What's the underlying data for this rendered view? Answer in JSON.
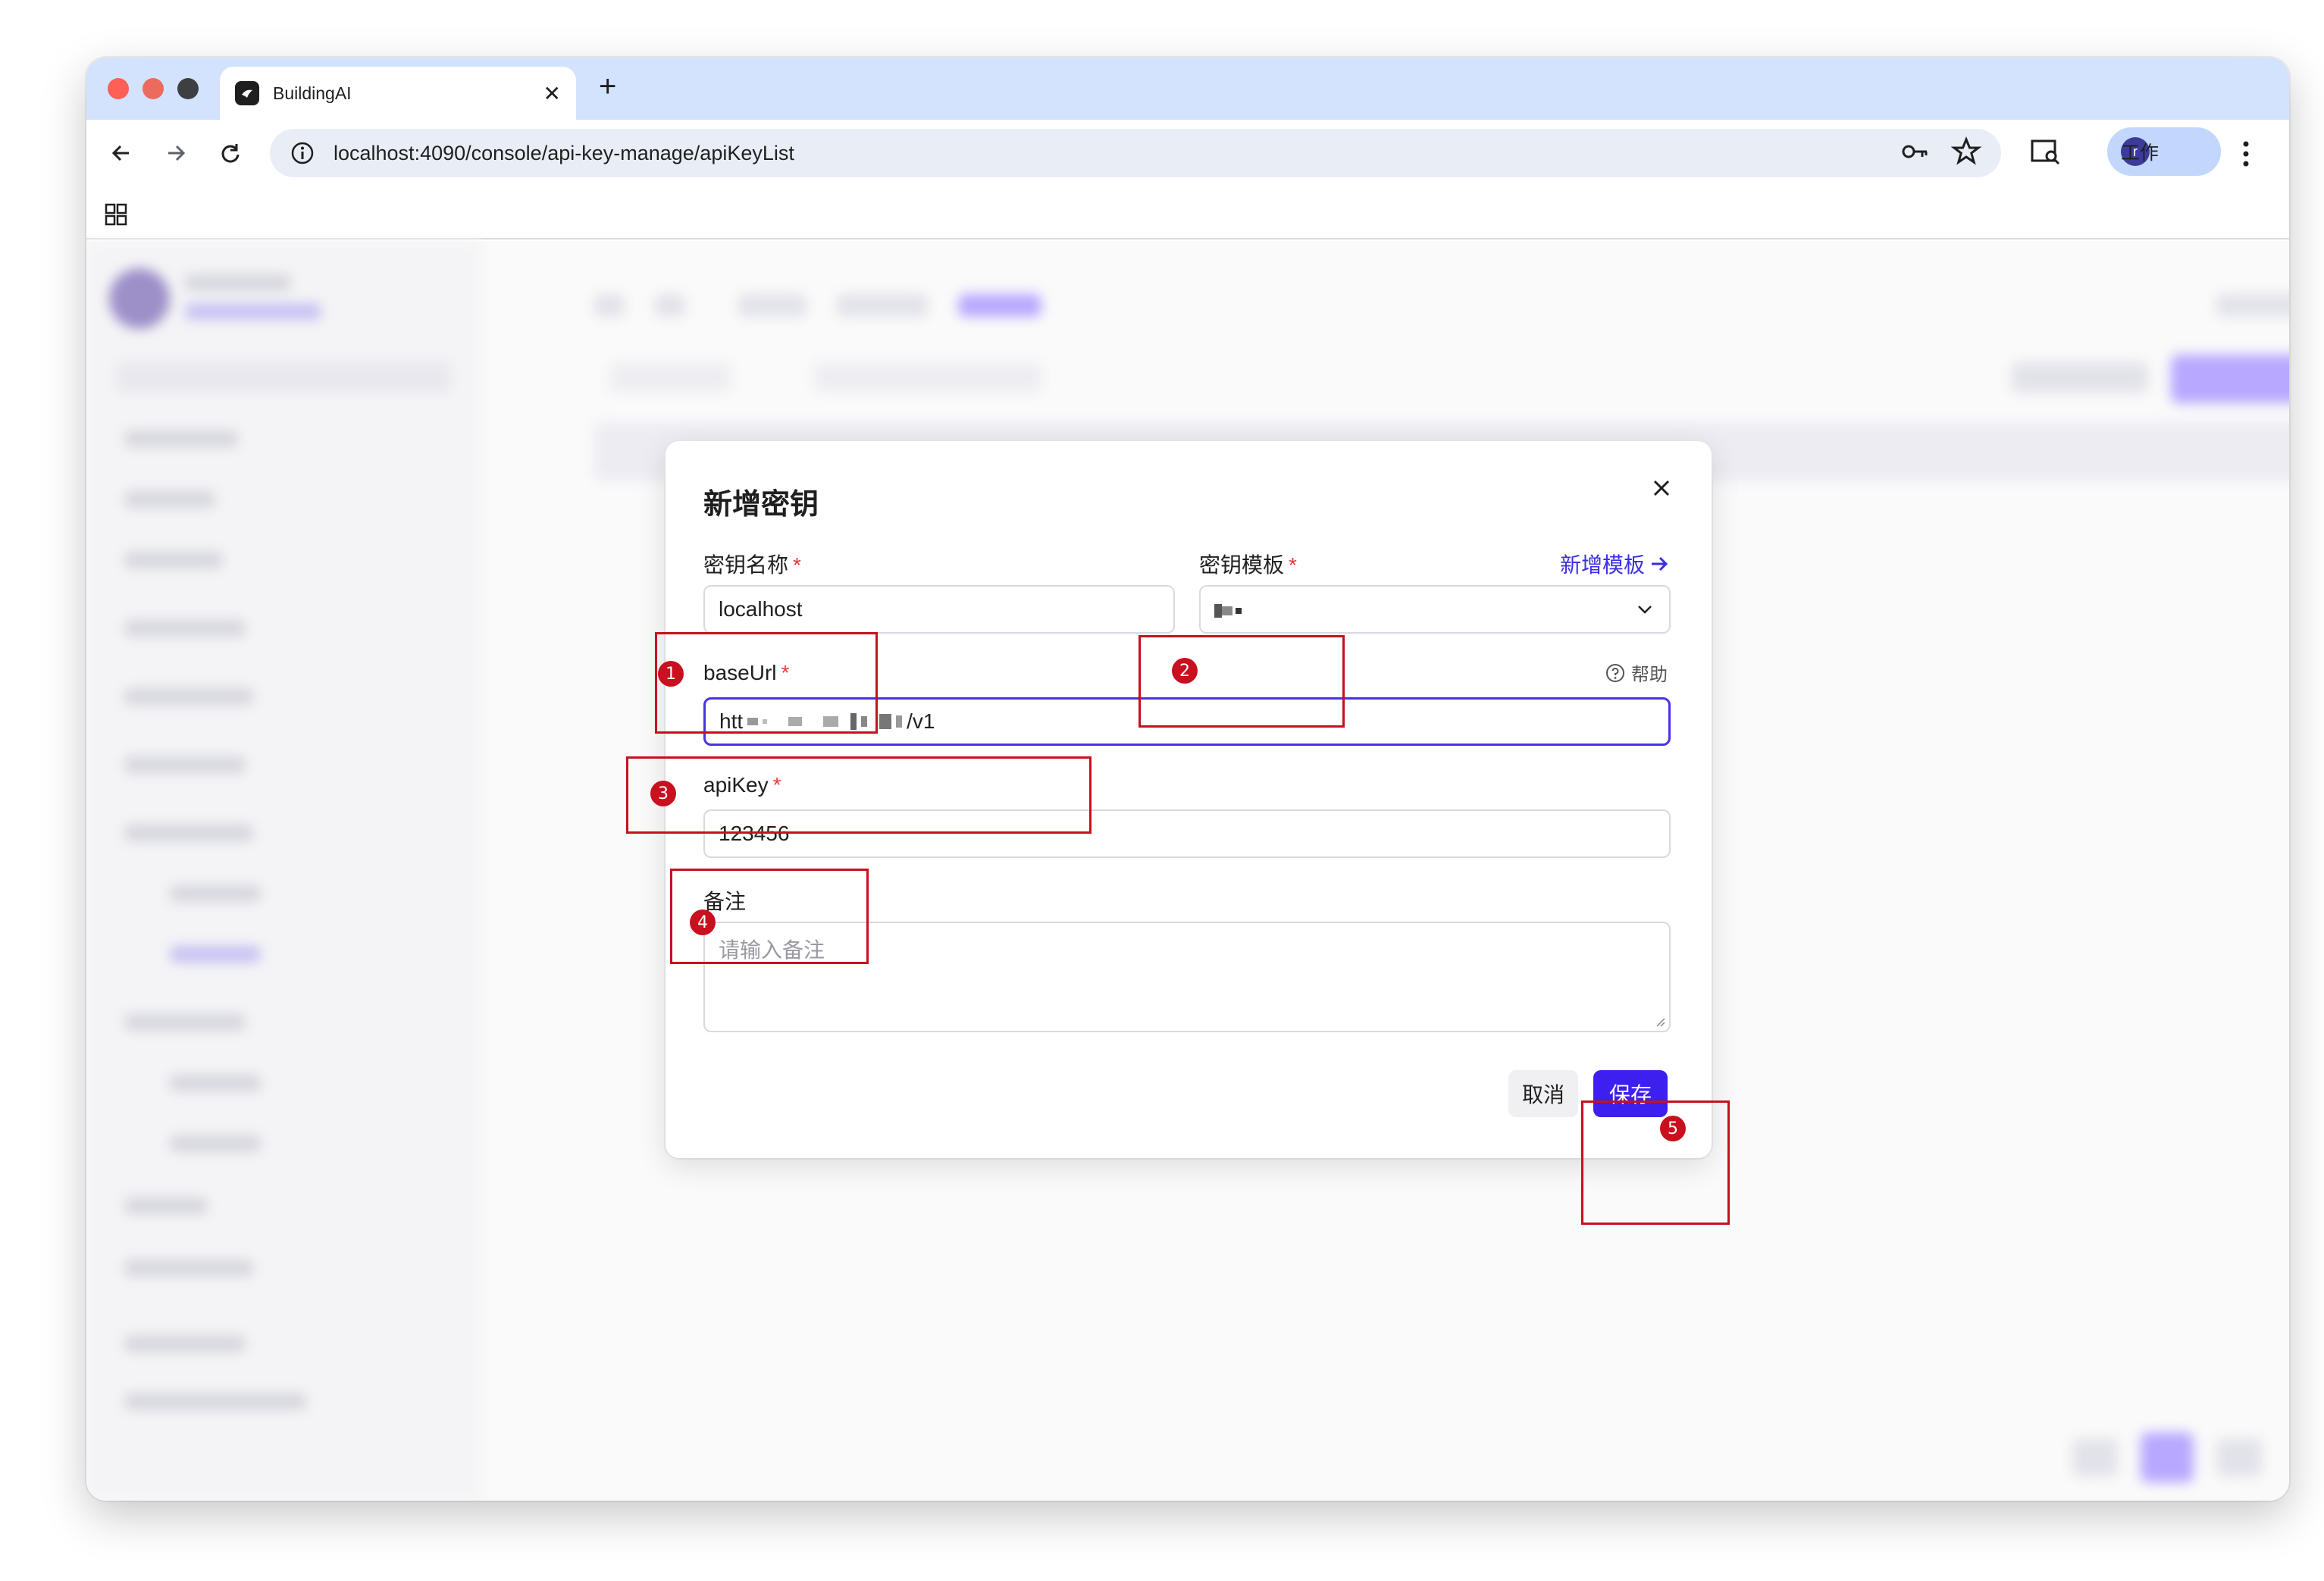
{
  "browser": {
    "tab_title": "BuildingAI",
    "new_tab_symbol": "+",
    "close_symbol": "✕",
    "url": "localhost:4090/console/api-key-manage/apiKeyList",
    "profile_initial": "r",
    "profile_label": "工作"
  },
  "dialog": {
    "title": "新增密钥",
    "key_name": {
      "label": "密钥名称",
      "required_mark": "*",
      "value": "localhost"
    },
    "key_template": {
      "label": "密钥模板",
      "required_mark": "*",
      "new_template_link": "新增模板"
    },
    "base_url": {
      "label": "baseUrl",
      "required_mark": "*",
      "value_prefix": "htt",
      "value_suffix": "/v1",
      "help_label": "帮助"
    },
    "api_key": {
      "label": "apiKey",
      "required_mark": "*",
      "value": "123456"
    },
    "remark": {
      "label": "备注",
      "placeholder": "请输入备注"
    },
    "cancel_label": "取消",
    "save_label": "保存"
  },
  "annotations": [
    "1",
    "2",
    "3",
    "4",
    "5"
  ],
  "colors": {
    "accent": "#3d1ff0",
    "annotation_red": "#c8101e",
    "tabstrip": "#d3e3fd"
  }
}
